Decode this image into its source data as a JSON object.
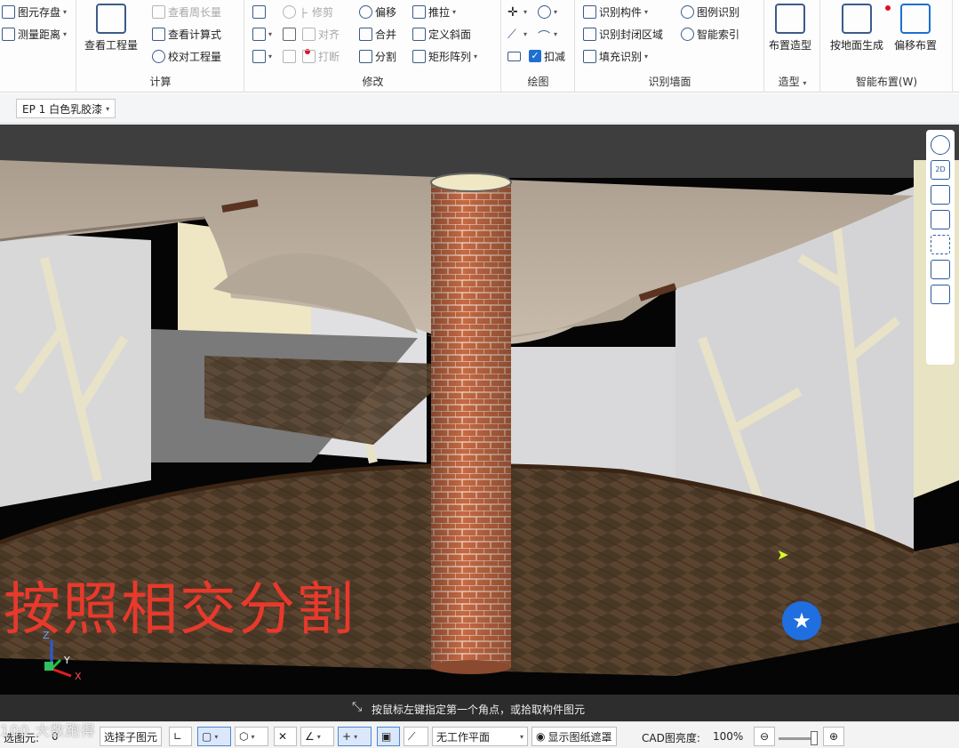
{
  "ribbon": {
    "file_group": {
      "element_save": "图元存盘",
      "measure_distance": "测量距离"
    },
    "calc_group": {
      "label": "计算",
      "view_quantity": "查看工程量",
      "view_perimeter": "查看周长量",
      "view_formula": "查看计算式",
      "check_quantity": "校对工程量"
    },
    "modify_group": {
      "label": "修改",
      "delete": "",
      "trim": "修剪",
      "offset": "偏移",
      "push_pull": "推拉",
      "align": "对齐",
      "merge": "合并",
      "define_slope": "定义斜面",
      "break": "打断",
      "split": "分割",
      "rect_array": "矩形阵列"
    },
    "draw_group": {
      "label": "绘图",
      "deduct": "扣减"
    },
    "recognize_group": {
      "label": "识别墙面",
      "recognize_component": "识别构件",
      "legend_recognize": "图例识别",
      "recognize_closed": "识别封闭区域",
      "smart_index": "智能索引",
      "fill_recognize": "填充识别"
    },
    "model_group": {
      "label": "造型",
      "place_model": "布置造型"
    },
    "smart_group": {
      "label": "智能布置(W)",
      "generate_by_face": "按地面生成",
      "offset_place": "偏移布置"
    }
  },
  "propbar": {
    "layer_select": "EP 1 白色乳胶漆"
  },
  "viewport": {
    "overlay_caption": "按照相交分割",
    "axis": {
      "x": "X",
      "y": "Y",
      "z": "Z"
    },
    "nav_toolbar": {
      "view_2d": "2D"
    }
  },
  "hintbar": {
    "text": "按鼠标左键指定第一个角点，或拾取构件图元"
  },
  "statusbar": {
    "selected_label": "选图元:",
    "selected_count": "0",
    "select_child": "选择子图元",
    "work_plane": "无工作平面",
    "show_drawing_mask": "显示图纸遮罩",
    "cad_brightness_label": "CAD图亮度:",
    "cad_brightness_value": "100%"
  },
  "watermark": "100 大数跑得",
  "colors": {
    "accent": "#1d6fd1",
    "caption": "#e8392c",
    "fav": "#1f6fe0"
  }
}
